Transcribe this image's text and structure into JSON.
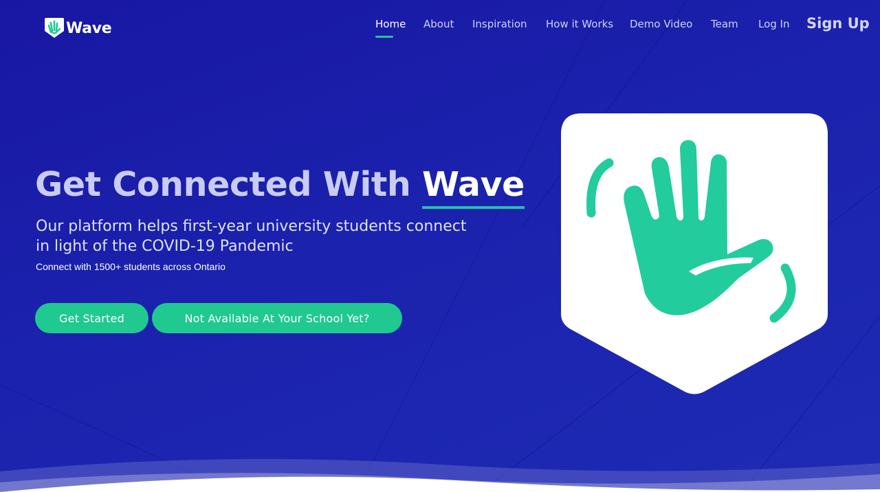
{
  "app": {
    "name": "Wave",
    "logo_icon": "wave-hand-logo-icon"
  },
  "nav": {
    "items": [
      {
        "label": "Home",
        "active": true
      },
      {
        "label": "About"
      },
      {
        "label": "Inspiration"
      },
      {
        "label": "How it Works"
      },
      {
        "label": "Demo Video"
      },
      {
        "label": "Team"
      },
      {
        "label": "Log In"
      }
    ],
    "signup_label": "Sign Up"
  },
  "hero": {
    "title_prefix": "Get Connected With ",
    "title_accent": "Wave",
    "subtitle": "Our platform helps first-year university students connect in light of the COVID-19 Pandemic",
    "tagline": "Connect with 1500+ students across Ontario",
    "buttons": {
      "primary": "Get Started",
      "secondary": "Not Available At Your School Yet?"
    },
    "illustration_icon": "waving-hand-shield-icon"
  },
  "colors": {
    "background": "#1a1fa8",
    "accent_green": "#21c995",
    "white": "#ffffff"
  }
}
